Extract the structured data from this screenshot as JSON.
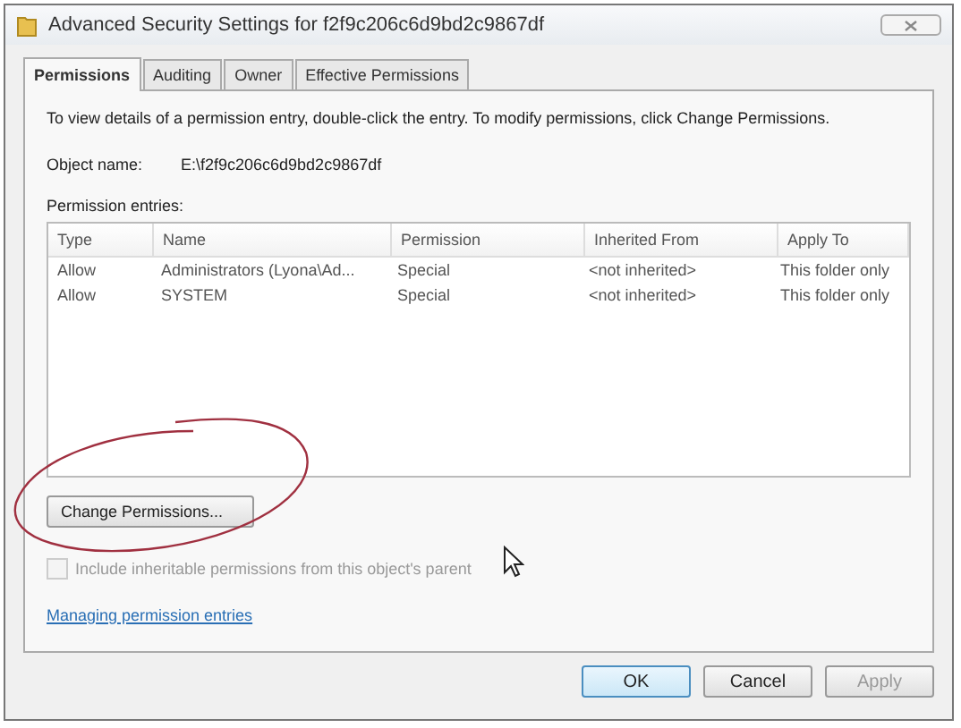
{
  "window": {
    "title": "Advanced Security Settings for f2f9c206c6d9bd2c9867df"
  },
  "tabs": [
    {
      "label": "Permissions",
      "selected": true
    },
    {
      "label": "Auditing",
      "selected": false
    },
    {
      "label": "Owner",
      "selected": false
    },
    {
      "label": "Effective Permissions",
      "selected": false
    }
  ],
  "instructions": "To view details of a permission entry, double-click the entry. To modify permissions, click Change Permissions.",
  "object_name": {
    "label": "Object name:",
    "value": "E:\\f2f9c206c6d9bd2c9867df"
  },
  "entries_label": "Permission entries:",
  "table": {
    "columns": [
      "Type",
      "Name",
      "Permission",
      "Inherited From",
      "Apply To"
    ],
    "rows": [
      [
        "Allow",
        "Administrators (Lyona\\Ad...",
        "Special",
        "<not inherited>",
        "This folder only"
      ],
      [
        "Allow",
        "SYSTEM",
        "Special",
        "<not inherited>",
        "This folder only"
      ]
    ]
  },
  "change_button": "Change Permissions...",
  "inherit_checkbox": {
    "label": "Include inheritable permissions from this object's parent",
    "checked": false,
    "disabled": true
  },
  "help_link": "Managing permission entries",
  "buttons": [
    {
      "label": "OK",
      "disabled": false
    },
    {
      "label": "Cancel",
      "disabled": false
    },
    {
      "label": "Apply",
      "disabled": true
    }
  ]
}
